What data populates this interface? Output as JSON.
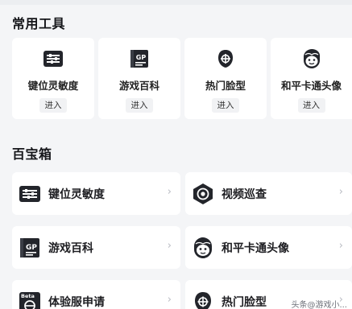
{
  "sections": {
    "tools_title": "常用工具",
    "box_title": "百宝箱"
  },
  "tools": [
    {
      "label": "键位灵敏度",
      "enter": "进入",
      "icon": "sliders-icon"
    },
    {
      "label": "游戏百科",
      "enter": "进入",
      "icon": "gp-book-icon"
    },
    {
      "label": "热门脸型",
      "enter": "进入",
      "icon": "face-target-icon"
    },
    {
      "label": "和平卡通头像",
      "enter": "进入",
      "icon": "cartoon-face-icon"
    }
  ],
  "box_items": [
    {
      "label": "键位灵敏度",
      "icon": "sliders-icon"
    },
    {
      "label": "视频巡查",
      "icon": "video-eye-icon"
    },
    {
      "label": "游戏百科",
      "icon": "gp-book-icon"
    },
    {
      "label": "和平卡通头像",
      "icon": "cartoon-face-icon"
    },
    {
      "label": "体验服申请",
      "icon": "beta-icon"
    },
    {
      "label": "热门脸型",
      "icon": "face-target-icon"
    }
  ],
  "chevron": "›",
  "watermark": "头条@游戏小...",
  "beta_badge": "Beta",
  "gp_badge": "GP",
  "colors": {
    "icon": "#23252b",
    "background": "#f4f5f7",
    "card": "#ffffff"
  }
}
